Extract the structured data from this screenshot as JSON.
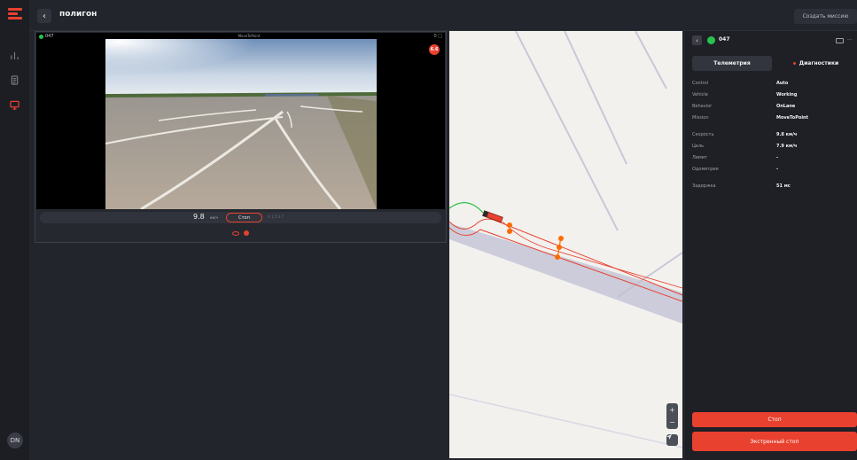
{
  "app": {
    "title": "полигон",
    "create_mission_label": "Создать миссию",
    "avatar_initials": "DN"
  },
  "camera": {
    "vehicle_id": "047",
    "mission_label": "MoveToPoint",
    "corner_text": "0",
    "badge": "6.6",
    "speed_value": "9.8",
    "speed_unit": "км/ч",
    "stop_label": "Стоп",
    "extra_text": "A 1.5 0.7"
  },
  "map": {
    "zoom_in": "+",
    "zoom_out": "−"
  },
  "panel": {
    "vehicle_id": "047",
    "tabs": [
      "Телеметрия",
      "Диагностики"
    ],
    "status_rows": [
      {
        "key": "Control",
        "value": "Auto"
      },
      {
        "key": "Vehicle",
        "value": "Working"
      },
      {
        "key": "Behavior",
        "value": "OnLane"
      },
      {
        "key": "Mission",
        "value": "MoveToPoint"
      }
    ],
    "metrics_rows": [
      {
        "key": "Скорость",
        "value": "9.8 км/ч"
      },
      {
        "key": "Цель",
        "value": "7.9 км/ч"
      },
      {
        "key": "Лимит",
        "value": "-"
      },
      {
        "key": "Одометрия",
        "value": "-"
      }
    ],
    "latency": {
      "key": "Задержка",
      "value": "51 мс"
    },
    "stop_label": "Стоп",
    "emergency_stop_label": "Экстренный стоп"
  },
  "colors": {
    "accent": "#e8412f",
    "online": "#27c24c",
    "background": "#22252c"
  }
}
